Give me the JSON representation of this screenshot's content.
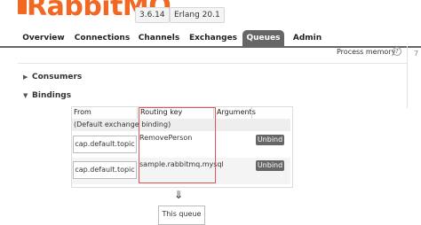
{
  "header": {
    "logo_text": "RabbitMQ",
    "version": "3.6.14",
    "erlang": "Erlang 20.1"
  },
  "nav": {
    "tabs": [
      {
        "label": "Overview",
        "active": false
      },
      {
        "label": "Connections",
        "active": false
      },
      {
        "label": "Channels",
        "active": false
      },
      {
        "label": "Exchanges",
        "active": false
      },
      {
        "label": "Queues",
        "active": true
      },
      {
        "label": "Admin",
        "active": false
      }
    ]
  },
  "status": {
    "process_memory_label": "Process memory",
    "help_glyph": "?",
    "edge_digit": "7"
  },
  "sections": {
    "consumers": {
      "label": "Consumers",
      "expanded": false
    },
    "bindings": {
      "label": "Bindings",
      "expanded": true
    }
  },
  "bindings_table": {
    "headers": {
      "from": "From",
      "routing_key": "Routing key",
      "arguments": "Arguments"
    },
    "default_binding": "(Default exchange binding)",
    "rows": [
      {
        "from": "cap.default.topic",
        "routing_key": "RemovePerson",
        "action": "Unbind"
      },
      {
        "from": "cap.default.topic",
        "routing_key": "sample.rabbitmq.mysql",
        "action": "Unbind"
      }
    ]
  },
  "flow": {
    "arrow_glyph": "⇓",
    "target_label": "This queue"
  },
  "colors": {
    "brand": "#f26722",
    "nav_active": "#666666",
    "unbind_button": "#666666",
    "highlight": "#e05555"
  },
  "icons": {
    "collapsed_caret": "triangle-right",
    "expanded_caret": "triangle-down",
    "arrow": "double-arrow-down"
  }
}
